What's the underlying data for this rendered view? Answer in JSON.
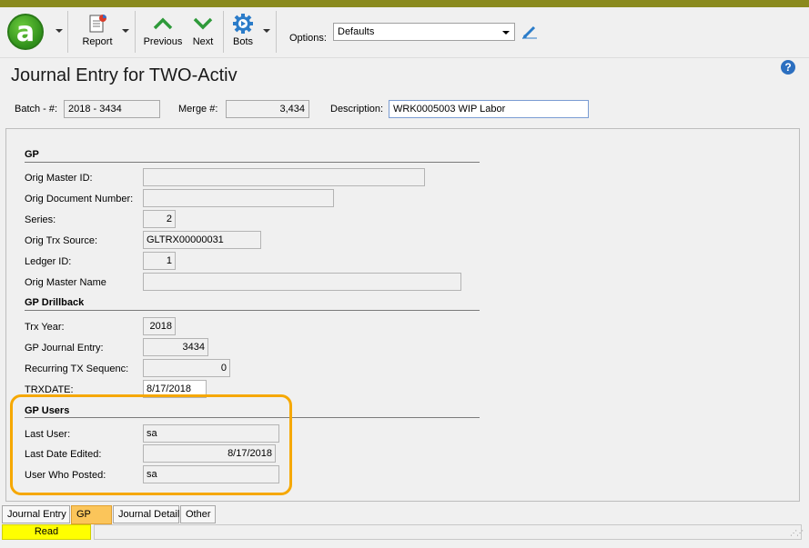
{
  "toolbar": {
    "report_label": "Report",
    "previous_label": "Previous",
    "next_label": "Next",
    "bots_label": "Bots",
    "options_label": "Options:",
    "options_value": "Defaults"
  },
  "title": "Journal Entry for TWO-Activ",
  "help": "?",
  "header": {
    "batch_label": "Batch - #:",
    "batch_value": "2018 - 3434",
    "merge_label": "Merge #:",
    "merge_value": "3,434",
    "description_label": "Description:",
    "description_value": "WRK0005003 WIP Labor"
  },
  "sections": {
    "gp": {
      "title": "GP",
      "orig_master_id_label": "Orig Master ID:",
      "orig_master_id": "",
      "orig_doc_number_label": "Orig Document Number:",
      "orig_doc_number": "",
      "series_label": "Series:",
      "series": "2",
      "orig_trx_source_label": "Orig Trx Source:",
      "orig_trx_source": "GLTRX00000031",
      "ledger_id_label": "Ledger ID:",
      "ledger_id": "1",
      "orig_master_name_label": "Orig Master Name",
      "orig_master_name": ""
    },
    "drillback": {
      "title": "GP Drillback",
      "trx_year_label": "Trx Year:",
      "trx_year": "2018",
      "gp_journal_entry_label": "GP Journal Entry:",
      "gp_journal_entry": "3434",
      "recurring_label": "Recurring TX Sequenc:",
      "recurring": "0",
      "trxdate_label": "TRXDATE:",
      "trxdate": "8/17/2018"
    },
    "users": {
      "title": "GP Users",
      "last_user_label": "Last User:",
      "last_user": "sa",
      "last_date_label": "Last Date Edited:",
      "last_date": "8/17/2018",
      "posted_label": "User Who Posted:",
      "posted": "sa"
    }
  },
  "tabs": [
    {
      "label": "Journal Entry"
    },
    {
      "label": "GP"
    },
    {
      "label": "Journal Detail"
    },
    {
      "label": "Other"
    }
  ],
  "status": "Read",
  "colors": {
    "highlight": "#f6a800",
    "active_tab": "#fbc55a",
    "status_read": "#ffff00",
    "top_bar": "#8a8a1e"
  }
}
